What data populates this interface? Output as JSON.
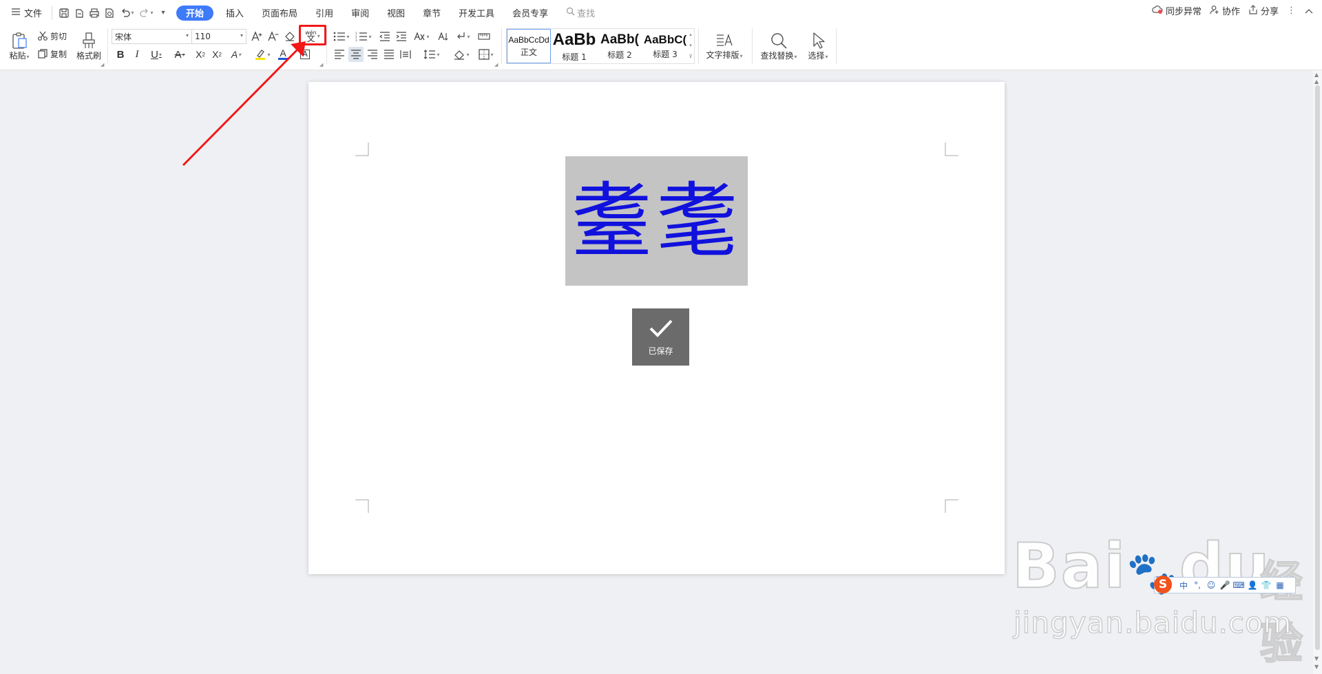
{
  "menubar": {
    "file_label": "文件",
    "tabs": [
      {
        "label": "开始",
        "active": true
      },
      {
        "label": "插入"
      },
      {
        "label": "页面布局"
      },
      {
        "label": "引用"
      },
      {
        "label": "审阅"
      },
      {
        "label": "视图"
      },
      {
        "label": "章节"
      },
      {
        "label": "开发工具"
      },
      {
        "label": "会员专享"
      }
    ],
    "search_label": "查找",
    "sync_label": "同步异常",
    "collab_label": "协作",
    "share_label": "分享"
  },
  "ribbon": {
    "paste_label": "粘贴",
    "cut_label": "剪切",
    "copy_label": "复制",
    "format_painter_label": "格式刷",
    "font_name": "宋体",
    "font_size": "110",
    "styles": [
      {
        "preview": "AaBbCcDd",
        "name": "正文",
        "selected": true
      },
      {
        "preview": "AaBb",
        "name": "标题 1"
      },
      {
        "preview": "AaBb(",
        "name": "标题 2"
      },
      {
        "preview": "AaBbC(",
        "name": "标题 3"
      }
    ],
    "text_layout_label": "文字排版",
    "find_replace_label": "查找替换",
    "select_label": "选择",
    "phonetic_icon_text": "wén 文"
  },
  "document": {
    "main_text": "耋耄",
    "saved_label": "已保存"
  },
  "watermark": {
    "brand": "Bai",
    "brand2": "du",
    "jingyan": "经验",
    "url": "jingyan.baidu.com"
  },
  "ime": {
    "logo": "S",
    "zhong": "中"
  },
  "colors": {
    "accent": "#3e7bfa",
    "highlight_box": "#f21818",
    "text_blue": "#1111dd",
    "graybox": "#c4c4c4"
  }
}
